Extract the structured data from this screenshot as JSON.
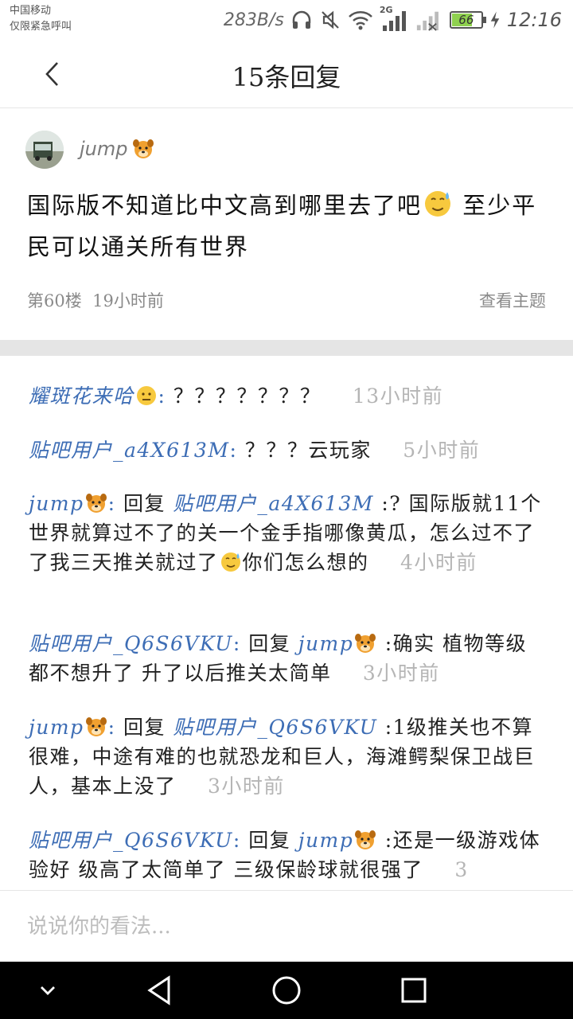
{
  "status_bar": {
    "carrier_line1": "中国移动",
    "carrier_line2": "仅限紧急呼叫",
    "net_speed": "283B/s",
    "network": "2G",
    "battery_level": 66,
    "battery_text": "66",
    "time": "12:16"
  },
  "header": {
    "title": "15条回复",
    "back_icon": "chevron-left-icon"
  },
  "post": {
    "author": "jump",
    "author_emoji": "dog-face-icon",
    "content_part1": "国际版不知道比中文高到哪里去了吧",
    "content_emoji": "sweat-smile-icon",
    "content_part2": " 至少平民可以通关所有世界",
    "floor": "第60楼",
    "time": "19小时前",
    "view_topic": "查看主题"
  },
  "replies": [
    {
      "user": "耀斑花来哈",
      "user_emoji": "neutral-face-icon",
      "colon": ":",
      "text": "？？？？？？？",
      "time": "13小时前"
    },
    {
      "user": "贴吧用户_a4X613M",
      "colon": ":",
      "text": "？？？云玩家",
      "time": "5小时前"
    },
    {
      "user": "jump",
      "user_emoji": "dog-face-icon",
      "colon": ":",
      "reply_word": "回复",
      "reply_to": "贴吧用户_a4X613M",
      "text_part1": ":? 国际版就11个世界就算过不了的关一个金手指哪像黄瓜，怎么过不了了我三天推关就过了",
      "text_emoji": "sweat-smile-icon",
      "text_part2": "你们怎么想的",
      "time": "4小时前"
    },
    {
      "user": "贴吧用户_Q6S6VKU",
      "colon": ":",
      "reply_word": "回复",
      "reply_to": "jump",
      "reply_to_emoji": "dog-face-icon",
      "text": ":确实 植物等级都不想升了 升了以后推关太简单",
      "time": "3小时前"
    },
    {
      "user": "jump",
      "user_emoji": "dog-face-icon",
      "colon": ":",
      "reply_word": "回复",
      "reply_to": "贴吧用户_Q6S6VKU",
      "text": ":1级推关也不算很难，中途有难的也就恐龙和巨人，海滩鳄梨保卫战巨人，基本上没了",
      "time": "3小时前"
    },
    {
      "user": "贴吧用户_Q6S6VKU",
      "colon": ":",
      "reply_word": "回复",
      "reply_to": "jump",
      "reply_to_emoji": "dog-face-icon",
      "text": ":还是一级游戏体验好 级高了太简单了 三级保龄球就很强了",
      "time": "3"
    }
  ],
  "comment_box": {
    "placeholder": "说说你的看法..."
  },
  "nav_bar": {
    "icons": [
      "chevron-down-icon",
      "back-triangle-icon",
      "home-circle-icon",
      "recents-square-icon"
    ]
  }
}
